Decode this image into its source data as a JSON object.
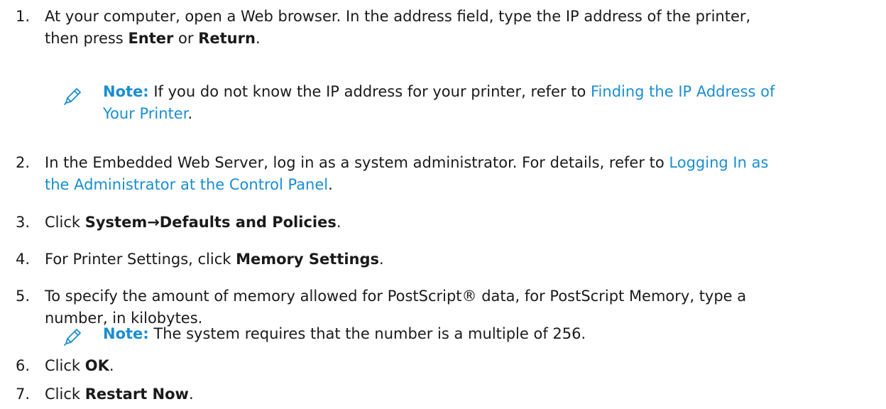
{
  "steps": [
    {
      "num": "1.",
      "t1": "At your computer, open a Web browser. In the address field, type the IP address of the printer,",
      "t2": "then press ",
      "b1": "Enter",
      "t3": " or ",
      "b2": "Return",
      "t4": "."
    },
    {
      "num": "2.",
      "t1": "In the Embedded Web Server, log in as a system administrator. For details, refer to ",
      "link1": "Logging In as",
      "link2": "the Administrator at the Control Panel",
      "t2": "."
    },
    {
      "num": "3.",
      "t1": "Click ",
      "b1": "System→Defaults and Policies",
      "t2": "."
    },
    {
      "num": "4.",
      "t1": "For Printer Settings, click ",
      "b1": "Memory Settings",
      "t2": "."
    },
    {
      "num": "5.",
      "t1": "To specify the amount of memory allowed for PostScript® data, for PostScript Memory, type a",
      "t2": "number, in kilobytes."
    },
    {
      "num": "6.",
      "t1": "Click ",
      "b1": "OK",
      "t2": "."
    },
    {
      "num": "7.",
      "t1": "Click ",
      "b1": "Restart Now",
      "t2": "."
    }
  ],
  "notes": [
    {
      "label": "Note:",
      "t1": " If you do not know the IP address for your printer, refer to ",
      "link1": "Finding the IP Address of",
      "link2": "Your Printer",
      "t2": "."
    },
    {
      "label": "Note:",
      "t1": " The system requires that the number is a multiple of 256."
    }
  ],
  "colors": {
    "link": "#1a8ed0",
    "note_label": "#1a8ed0",
    "icon": "#1a8ed0"
  },
  "icons": {
    "note": "pencil-icon"
  }
}
